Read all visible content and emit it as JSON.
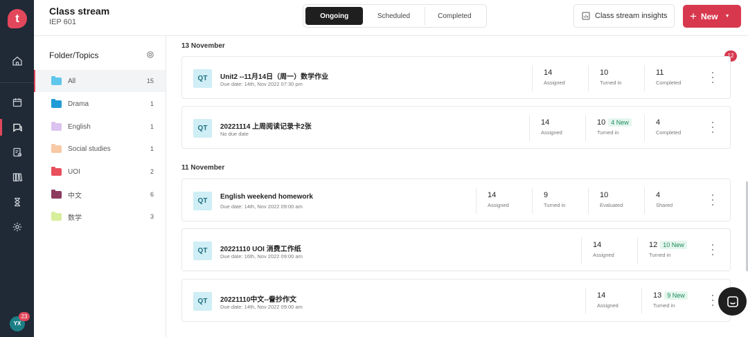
{
  "app": {
    "logo_letter": "t"
  },
  "rail": {
    "avatar_initials": "YX",
    "avatar_badge": "23"
  },
  "header": {
    "title": "Class stream",
    "subtitle": "IEP 601",
    "tabs": [
      "Ongoing",
      "Scheduled",
      "Completed"
    ],
    "insights_label": "Class stream insights",
    "new_label": "New"
  },
  "folders": {
    "title": "Folder/Topics",
    "items": [
      {
        "label": "All",
        "count": "15",
        "color": "#5fc6ec"
      },
      {
        "label": "Drama",
        "count": "1",
        "color": "#1f9cd6"
      },
      {
        "label": "English",
        "count": "1",
        "color": "#dcc3ef"
      },
      {
        "label": "Social studies",
        "count": "1",
        "color": "#f7c9a4"
      },
      {
        "label": "UOI",
        "count": "2",
        "color": "#e8505b"
      },
      {
        "label": "中文",
        "count": "6",
        "color": "#8e3a5e"
      },
      {
        "label": "数学",
        "count": "3",
        "color": "#d7ee9c"
      }
    ]
  },
  "stream": {
    "notification_badge": "12",
    "date_groups": [
      "13 November",
      "11 November"
    ],
    "assignments": [
      {
        "badge": "QT",
        "title": "Unit2 --11月14日（周一）数学作业",
        "due": "Due date: 14th, Nov 2022 07:30 pm",
        "stats": [
          {
            "value": "14",
            "label": "Assigned",
            "new": ""
          },
          {
            "value": "10",
            "label": "Turned in",
            "new": ""
          },
          {
            "value": "11",
            "label": "Completed",
            "new": ""
          }
        ]
      },
      {
        "badge": "QT",
        "title": "20221114 上周阅读记录卡2张",
        "due": "No due date",
        "stats": [
          {
            "value": "14",
            "label": "Assigned",
            "new": ""
          },
          {
            "value": "10",
            "label": "Turned in",
            "new": "4 New"
          },
          {
            "value": "4",
            "label": "Completed",
            "new": ""
          }
        ]
      },
      {
        "badge": "QT",
        "title": "English weekend homework",
        "due": "Due date: 14th, Nov 2022 09:00 am",
        "stats": [
          {
            "value": "14",
            "label": "Assigned",
            "new": ""
          },
          {
            "value": "9",
            "label": "Turned in",
            "new": ""
          },
          {
            "value": "10",
            "label": "Evaluated",
            "new": ""
          },
          {
            "value": "4",
            "label": "Shared",
            "new": ""
          }
        ]
      },
      {
        "badge": "QT",
        "title": "20221110 UOI 消费工作纸",
        "due": "Due date: 16th, Nov 2022 09:00 am",
        "stats": [
          {
            "value": "14",
            "label": "Assigned",
            "new": ""
          },
          {
            "value": "12",
            "label": "Turned in",
            "new": "10 New"
          }
        ]
      },
      {
        "badge": "QT",
        "title": "20221110中文--誊抄作文",
        "due": "Due date: 14th, Nov 2022 09:00 am",
        "stats": [
          {
            "value": "14",
            "label": "Assigned",
            "new": ""
          },
          {
            "value": "13",
            "label": "Turned in",
            "new": "9 New"
          }
        ]
      }
    ]
  }
}
